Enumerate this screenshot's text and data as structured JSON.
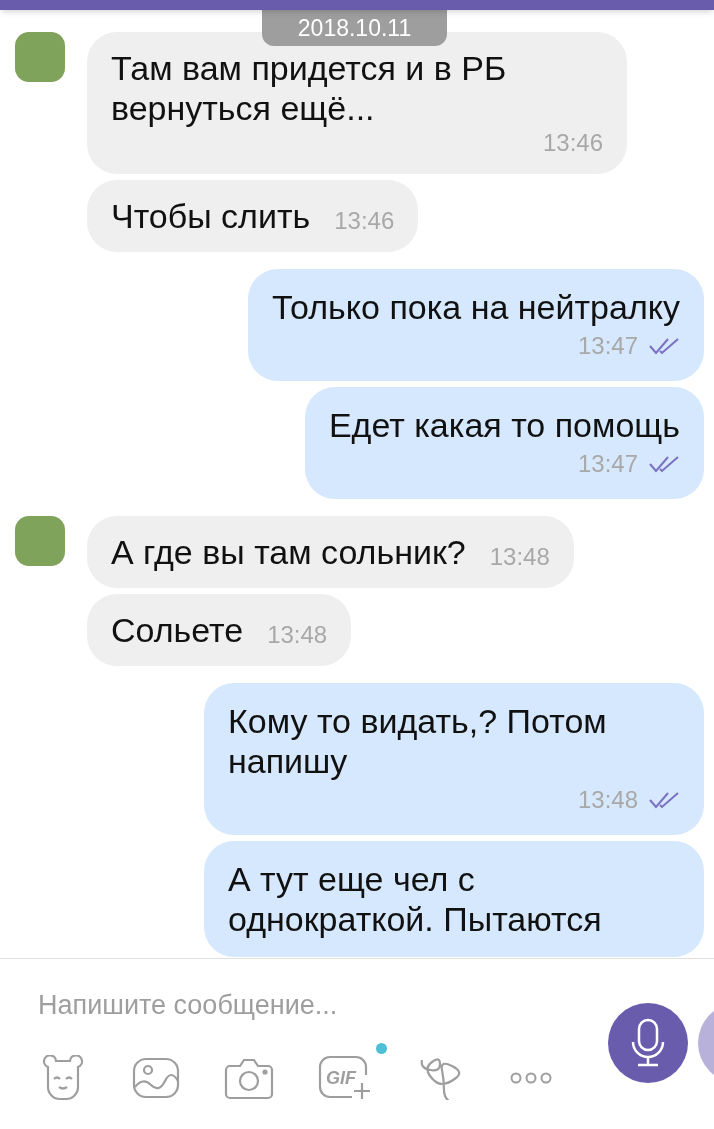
{
  "date_pill": "2018.10.11",
  "messages": [
    {
      "kind": "incoming",
      "avatar": true,
      "text": "Там вам придется и в РБ вернуться ещё...",
      "time": "13:46"
    },
    {
      "kind": "incoming",
      "avatar": false,
      "text": "Чтобы слить",
      "time": "13:46"
    },
    {
      "kind": "outgoing",
      "text": "Только пока на нейтралку",
      "time": "13:47",
      "read": true
    },
    {
      "kind": "outgoing",
      "text": "Едет какая то помощь",
      "time": "13:47",
      "read": true
    },
    {
      "kind": "incoming",
      "avatar": true,
      "text": "А где вы там сольник?",
      "time": "13:48"
    },
    {
      "kind": "incoming",
      "avatar": false,
      "text": "Сольете",
      "time": "13:48"
    },
    {
      "kind": "outgoing",
      "text": "Кому то видать,? Потом напишу",
      "time": "13:48",
      "read": true
    },
    {
      "kind": "outgoing",
      "text": "А тут еще чел с однократкой. Пытаются"
    }
  ],
  "composer": {
    "placeholder": "Напишите сообщение...",
    "gif_label": "GIF",
    "gif_new": true
  }
}
